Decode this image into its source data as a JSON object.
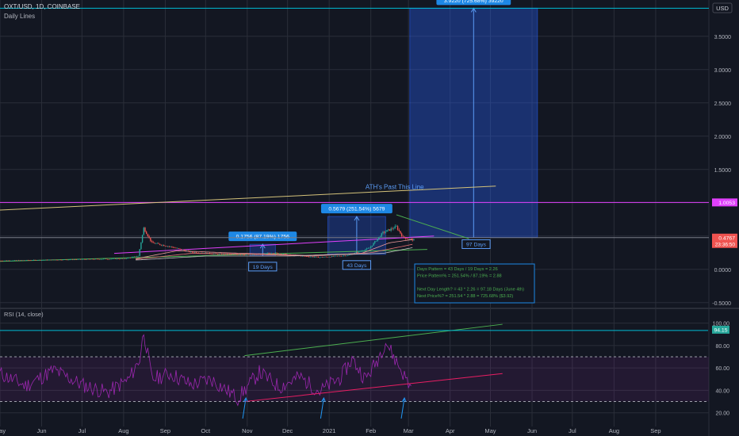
{
  "header": {
    "symbol": "OXT/USD, 1D, COINBASE",
    "indicator": "Daily Lines",
    "currency": "USD"
  },
  "colors": {
    "background": "#131722",
    "grid": "#2a2e39",
    "axis_text": "#b2b5be",
    "candle_up": "#26a69a",
    "candle_down": "#ef5350",
    "magenta": "#e040fb",
    "green": "#4caf50",
    "yellow": "#d4c27a",
    "blue": "#2962ff",
    "cyan": "#00bcd4",
    "rsi": "#9c27b0",
    "rsi_pink": "#e91e63"
  },
  "chart_data": [
    {
      "type": "candlestick",
      "pane": "price",
      "x_axis": {
        "type": "date",
        "range": [
          "2020-05-01",
          "2021-10-10"
        ],
        "tick_labels": [
          "May",
          "Jun",
          "Jul",
          "Aug",
          "Sep",
          "Oct",
          "Nov",
          "Dec",
          "2021",
          "Feb",
          "Mar",
          "Apr",
          "May",
          "Jun",
          "Jul",
          "Aug",
          "Sep"
        ],
        "tick_dates": [
          "2020-05-01",
          "2020-06-01",
          "2020-07-01",
          "2020-08-01",
          "2020-09-01",
          "2020-10-01",
          "2020-11-01",
          "2020-12-01",
          "2021-01-01",
          "2021-02-01",
          "2021-03-01",
          "2021-04-01",
          "2021-05-01",
          "2021-06-01",
          "2021-07-01",
          "2021-08-01",
          "2021-09-01"
        ]
      },
      "y_axis": {
        "range": [
          -0.55,
          3.95
        ],
        "ticks": [
          -0.5,
          0.0,
          0.5,
          1.0,
          1.5,
          2.0,
          2.5,
          3.0,
          3.5
        ],
        "tick_labels": [
          "-0.5000",
          "0.0000",
          "0.5000",
          "1.0000",
          "1.5000",
          "2.0000",
          "2.5000",
          "3.0000",
          "3.5000"
        ]
      },
      "price_anchors": [
        [
          "2020-05-01",
          0.13
        ],
        [
          "2020-06-01",
          0.14
        ],
        [
          "2020-07-01",
          0.15
        ],
        [
          "2020-08-01",
          0.16
        ],
        [
          "2020-08-12",
          0.2
        ],
        [
          "2020-08-16",
          0.62
        ],
        [
          "2020-08-22",
          0.4
        ],
        [
          "2020-09-05",
          0.34
        ],
        [
          "2020-09-20",
          0.26
        ],
        [
          "2020-10-10",
          0.23
        ],
        [
          "2020-11-05",
          0.22
        ],
        [
          "2020-11-20",
          0.25
        ],
        [
          "2020-12-05",
          0.21
        ],
        [
          "2020-12-25",
          0.18
        ],
        [
          "2021-01-15",
          0.21
        ],
        [
          "2021-01-31",
          0.32
        ],
        [
          "2021-02-10",
          0.55
        ],
        [
          "2021-02-20",
          0.64
        ],
        [
          "2021-02-25",
          0.48
        ],
        [
          "2021-03-05",
          0.44
        ]
      ],
      "moving_averages": [
        {
          "anchors": [
            [
              "2020-08-10",
              0.16
            ],
            [
              "2020-09-10",
              0.28
            ],
            [
              "2020-10-15",
              0.25
            ],
            [
              "2020-12-15",
              0.21
            ],
            [
              "2021-01-25",
              0.24
            ],
            [
              "2021-02-15",
              0.4
            ],
            [
              "2021-03-05",
              0.45
            ]
          ]
        },
        {
          "anchors": [
            [
              "2020-08-10",
              0.15
            ],
            [
              "2020-09-20",
              0.24
            ],
            [
              "2020-11-01",
              0.23
            ],
            [
              "2020-12-20",
              0.2
            ],
            [
              "2021-02-01",
              0.25
            ],
            [
              "2021-03-05",
              0.38
            ]
          ]
        },
        {
          "anchors": [
            [
              "2020-08-10",
              0.14
            ],
            [
              "2020-10-01",
              0.2
            ],
            [
              "2020-12-01",
              0.2
            ],
            [
              "2021-02-10",
              0.24
            ],
            [
              "2021-03-05",
              0.33
            ]
          ]
        }
      ],
      "horizontal_lines": [
        {
          "value": 3.922,
          "color": "cyan"
        },
        {
          "value": 1.0053,
          "color": "magenta",
          "label": "1.0053"
        },
        {
          "value": 0.4767,
          "color": "gray",
          "label": "0.4767",
          "sublabel": "23:36:50"
        }
      ],
      "trend_lines": [
        {
          "color": "yellow",
          "from": [
            "2020-05-01",
            0.89
          ],
          "to": [
            "2021-05-05",
            1.25
          ],
          "label": "ATH's Past This Line"
        },
        {
          "color": "green",
          "from": [
            "2020-05-01",
            0.12
          ],
          "to": [
            "2021-03-15",
            0.3
          ]
        },
        {
          "color": "green",
          "from": [
            "2021-02-20",
            0.82
          ],
          "to": [
            "2021-04-15",
            0.46
          ]
        },
        {
          "color": "magenta",
          "from": [
            "2020-07-25",
            0.24
          ],
          "to": [
            "2021-03-20",
            0.5
          ]
        }
      ],
      "measure_boxes": [
        {
          "label": "0.1756 (87.19%) 1756",
          "from": [
            "2020-11-03",
            0.202
          ],
          "to": [
            "2020-11-22",
            0.377
          ],
          "footer": "19 Days"
        },
        {
          "label": "0.5679 (251.54%) 5679",
          "from": [
            "2020-12-31",
            0.226
          ],
          "to": [
            "2021-02-12",
            0.794
          ],
          "footer": "43 Days"
        },
        {
          "label": "3.9220 (725.68%) 39220",
          "from": [
            "2021-03-02",
            0.48
          ],
          "to": [
            "2021-06-05",
            3.922
          ],
          "footer": "97 Days"
        }
      ],
      "annotation": {
        "lines": [
          "Days Pattern = 43 Days / 19 Days = 2.26",
          "Price Pattern% = 251.54% / 87.19% = 2.88",
          "",
          "Next Day Length? = 43 * 2.26 = 97.18 Days (June 4th)",
          "Next Price%? = 251.54 * 2.88 = 725.68% ($3.92)"
        ]
      }
    },
    {
      "type": "line",
      "pane": "rsi",
      "title": "RSI (14, close)",
      "y_axis": {
        "range": [
          12,
          104
        ],
        "ticks": [
          20,
          40,
          60,
          80,
          100
        ],
        "tick_labels": [
          "20.00",
          "40.00",
          "60.00",
          "80.00",
          "100.00"
        ]
      },
      "band": {
        "upper": 70,
        "lower": 30
      },
      "current_value": {
        "value": 94.15,
        "label": "94.15"
      },
      "rsi_anchors": [
        [
          "2020-05-01",
          55
        ],
        [
          "2020-05-20",
          44
        ],
        [
          "2020-06-10",
          58
        ],
        [
          "2020-07-01",
          45
        ],
        [
          "2020-07-20",
          38
        ],
        [
          "2020-08-05",
          50
        ],
        [
          "2020-08-13",
          68
        ],
        [
          "2020-08-16",
          93
        ],
        [
          "2020-08-22",
          50
        ],
        [
          "2020-09-05",
          55
        ],
        [
          "2020-09-20",
          45
        ],
        [
          "2020-10-05",
          50
        ],
        [
          "2020-10-25",
          33
        ],
        [
          "2020-11-10",
          56
        ],
        [
          "2020-11-25",
          43
        ],
        [
          "2020-12-10",
          52
        ],
        [
          "2020-12-25",
          39
        ],
        [
          "2021-01-10",
          52
        ],
        [
          "2021-01-18",
          68
        ],
        [
          "2021-01-28",
          50
        ],
        [
          "2021-02-05",
          65
        ],
        [
          "2021-02-12",
          84
        ],
        [
          "2021-02-18",
          70
        ],
        [
          "2021-02-25",
          55
        ],
        [
          "2021-03-03",
          42
        ]
      ],
      "trend_lines": [
        {
          "color": "green",
          "from": [
            "2020-10-30",
            71
          ],
          "to": [
            "2021-05-10",
            99
          ]
        },
        {
          "color": "cyan",
          "from": [
            "2020-05-01",
            93.5
          ],
          "to": [
            "2021-10-10",
            93.5
          ]
        },
        {
          "color": "rsi_pink",
          "from": [
            "2020-10-30",
            30
          ],
          "to": [
            "2021-05-10",
            55
          ]
        }
      ],
      "arrows_at": [
        "2020-10-31",
        "2020-12-28",
        "2021-02-26"
      ]
    }
  ]
}
